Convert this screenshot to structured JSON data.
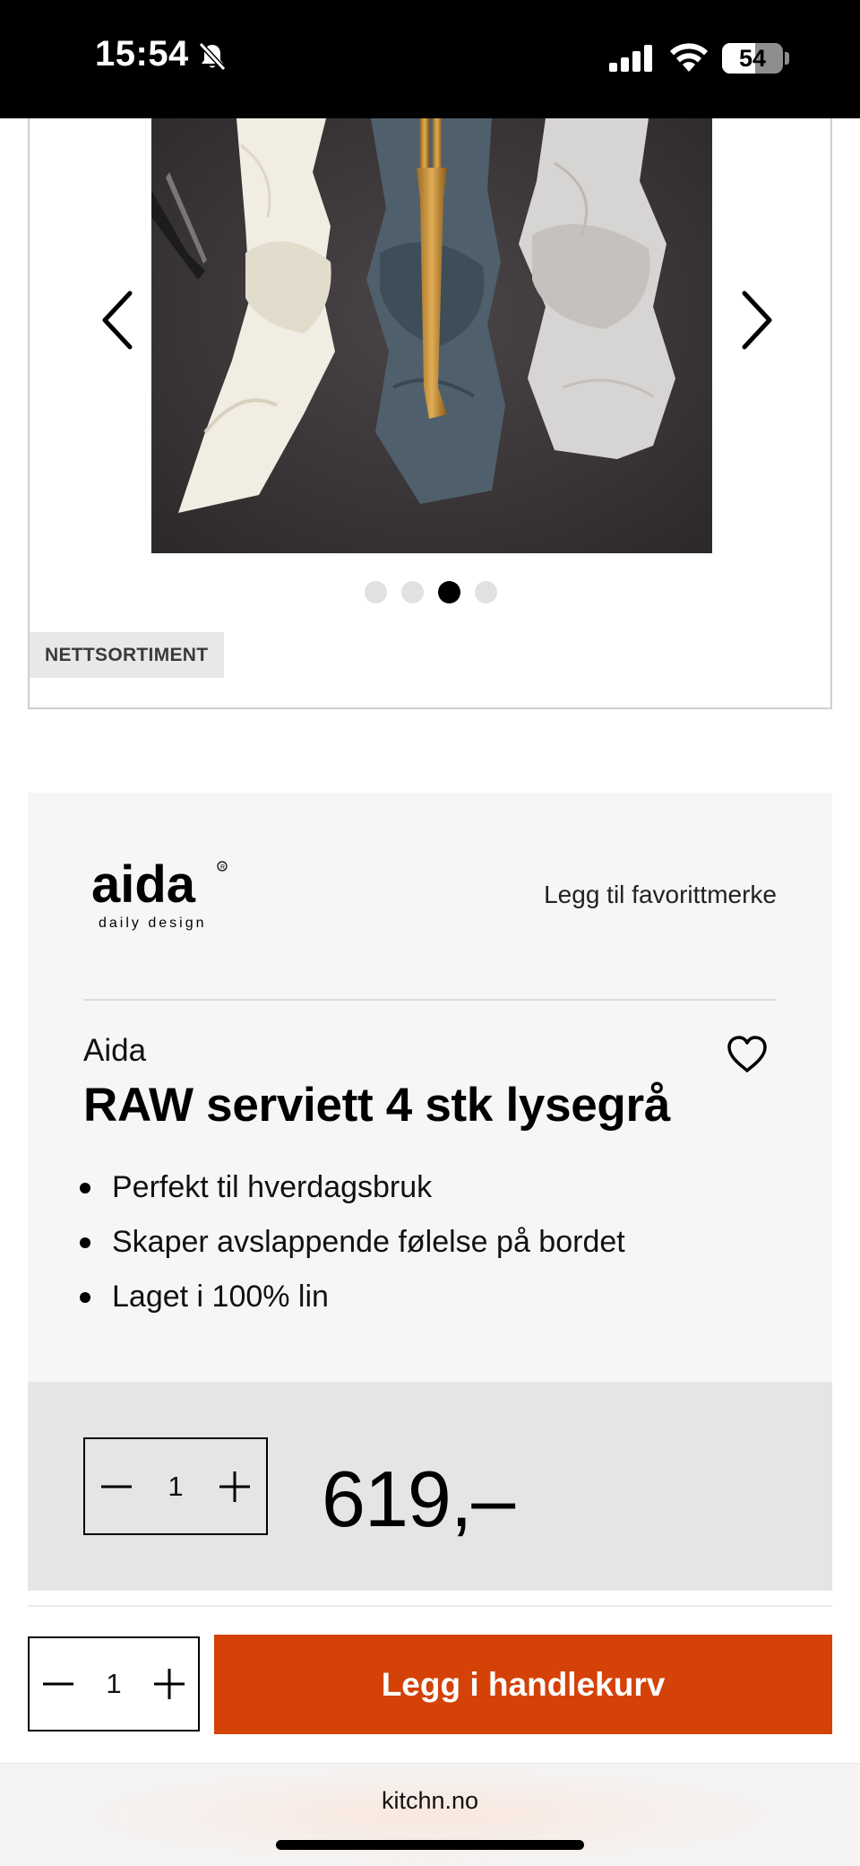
{
  "status_bar": {
    "time": "15:54",
    "battery_level": "54",
    "battery_percent": 54
  },
  "gallery": {
    "image_alt": "RAW serviett 4 stk lysegrå",
    "current_slide": 3,
    "total_slides": 4,
    "badge": "NETTSORTIMENT",
    "prev_icon": "chevron-left-icon",
    "next_icon": "chevron-right-icon"
  },
  "brand": {
    "logo_word": "aida",
    "logo_tagline": "daily design",
    "favorite_brand_label": "Legg til favorittmerke"
  },
  "product": {
    "brand_name": "Aida",
    "title": "RAW serviett 4 stk lysegrå",
    "features": [
      "Perfekt til hverdagsbruk",
      "Skaper avslappende følelse på bordet",
      "Laget i 100% lin"
    ],
    "quantity": "1",
    "price": "619,–"
  },
  "sticky_bar": {
    "quantity": "1",
    "add_to_cart_label": "Legg i handlekurv"
  },
  "browser": {
    "url": "kitchn.no"
  },
  "colors": {
    "accent": "#d44207",
    "panel_background": "#f6f6f6",
    "price_band_background": "#e5e5e5"
  }
}
